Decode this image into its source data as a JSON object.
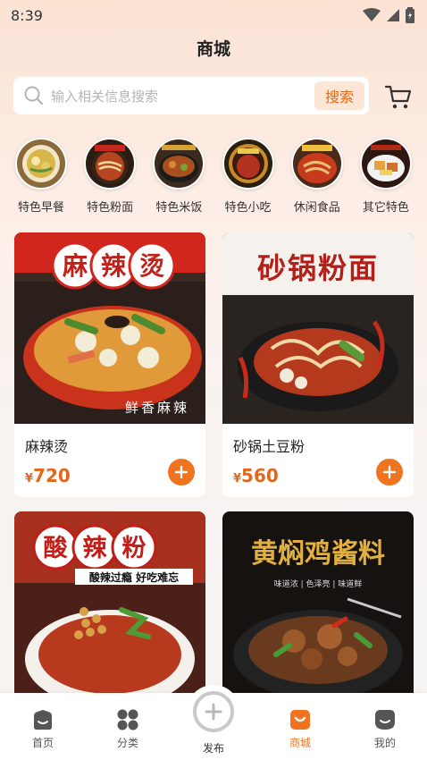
{
  "status_bar": {
    "time": "8:39"
  },
  "header": {
    "title": "商城"
  },
  "search": {
    "placeholder": "输入相关信息搜索",
    "button_label": "搜索"
  },
  "categories": [
    {
      "label": "特色早餐",
      "icon": "breakfast-dish"
    },
    {
      "label": "特色粉面",
      "icon": "noodle-dish"
    },
    {
      "label": "特色米饭",
      "icon": "rice-dish"
    },
    {
      "label": "特色小吃",
      "icon": "snack-dish"
    },
    {
      "label": "休闲食品",
      "icon": "leisure-food"
    },
    {
      "label": "其它特色",
      "icon": "other-dish"
    }
  ],
  "products": [
    {
      "name": "麻辣烫",
      "currency": "¥",
      "price": "720",
      "banner": "麻辣烫",
      "tagline": "鲜香麻辣"
    },
    {
      "name": "砂锅土豆粉",
      "currency": "¥",
      "price": "560",
      "banner": "砂锅粉面"
    },
    {
      "banner": "酸辣粉",
      "tagline": "酸辣过瘾 好吃难忘"
    },
    {
      "banner": "黄焖鸡酱料",
      "tagline": "味道浓 | 色泽亮 | 味道鲜"
    }
  ],
  "tabbar": {
    "items": [
      {
        "label": "首页",
        "icon": "home-icon"
      },
      {
        "label": "分类",
        "icon": "category-icon"
      },
      {
        "label": "发布",
        "icon": "plus-icon"
      },
      {
        "label": "商城",
        "icon": "shop-icon"
      },
      {
        "label": "我的",
        "icon": "profile-icon"
      }
    ],
    "active": "商城"
  },
  "colors": {
    "accent": "#f07320",
    "price": "#e4671c",
    "search_btn_bg": "#fde6d6"
  }
}
